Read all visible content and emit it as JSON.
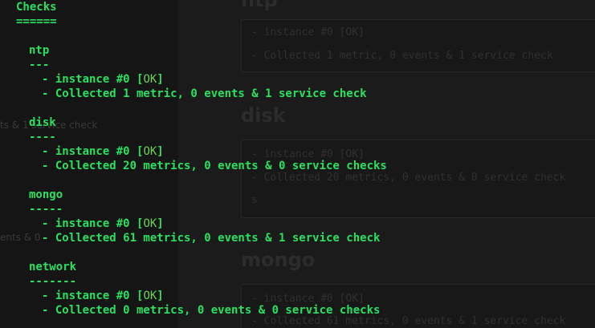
{
  "background": {
    "ghost_lines": [
      "ts & 1 service check",
      "ents & 0"
    ],
    "sections": [
      {
        "title": "ntp",
        "lines": [
          "- instance #0 [OK]",
          "- Collected 1 metric, 0 events & 1 service check"
        ]
      },
      {
        "title": "disk",
        "lines": [
          "- instance #0 [OK]",
          "- Collected 20 metrics, 0 events & 0 service check",
          "s"
        ]
      },
      {
        "title": "mongo",
        "lines": [
          "- instance #0 [OK]",
          "- Collected 61 metrics, 0 events & 1 service check"
        ]
      }
    ]
  },
  "terminal": {
    "heading": "Checks",
    "heading_underline": "======",
    "checks": [
      {
        "name": "ntp",
        "underline": "---",
        "instance_prefix": "- instance #0 [",
        "status": "OK",
        "instance_suffix": "]",
        "collected": "- Collected 1 metric, 0 events & 1 service check"
      },
      {
        "name": "disk",
        "underline": "----",
        "instance_prefix": "- instance #0 [",
        "status": "OK",
        "instance_suffix": "]",
        "collected": "- Collected 20 metrics, 0 events & 0 service checks"
      },
      {
        "name": "mongo",
        "underline": "-----",
        "instance_prefix": "- instance #0 [",
        "status": "OK",
        "instance_suffix": "]",
        "collected": "- Collected 61 metrics, 0 events & 1 service check"
      },
      {
        "name": "network",
        "underline": "-------",
        "instance_prefix": "- instance #0 [",
        "status": "OK",
        "instance_suffix": "]",
        "collected": "- Collected 0 metrics, 0 events & 0 service checks"
      }
    ]
  },
  "colors": {
    "terminal_text": "#29e05f",
    "ok_text": "#6fcf5a",
    "background": "#141414"
  }
}
